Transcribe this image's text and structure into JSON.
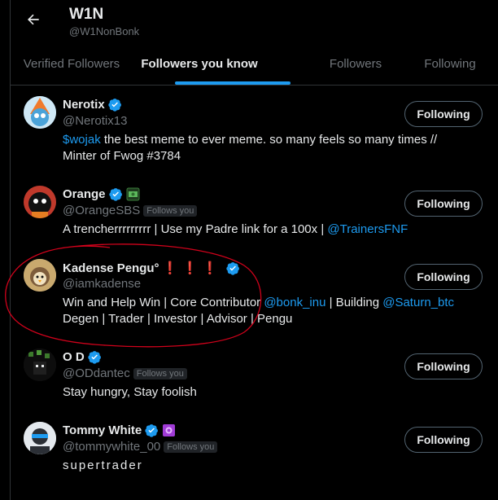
{
  "header": {
    "title": "W1N",
    "handle": "@W1NonBonk"
  },
  "tabs": [
    {
      "label": "Verified Followers",
      "active": false
    },
    {
      "label": "Followers you know",
      "active": true
    },
    {
      "label": "Followers",
      "active": false
    },
    {
      "label": "Following",
      "active": false
    }
  ],
  "colors": {
    "accent": "#1d9bf0",
    "red_annotation": "#d0021b",
    "background": "#000000"
  },
  "users": [
    {
      "name": "Nerotix",
      "handle": "@Nerotix13",
      "follows_you": false,
      "bio_line1_link": "$wojak",
      "bio_line1_rest": " the best meme to ever meme. so many feels so many times //",
      "bio_line2": "Minter of Fwog #3784",
      "button": "Following"
    },
    {
      "name": "Orange",
      "handle": "@OrangeSBS",
      "follows_you": true,
      "follows_you_label": "Follows you",
      "bio_text": "A trencherrrrrrrrr | Use my Padre link for a 100x | ",
      "bio_link": "@TrainersFNF",
      "button": "Following"
    },
    {
      "name": "Kadense Pengu°",
      "name_marks": "❗❗❗",
      "handle": "@iamkadense",
      "follows_you": false,
      "bio_part1": "Win and Help Win | Core Contributor ",
      "bio_link1": "@bonk_inu",
      "bio_part2": " | Building ",
      "bio_link2": "@Saturn_btc",
      "bio_line2": "Degen | Trader | Investor | Advisor | Pengu",
      "button": "Following"
    },
    {
      "name": "O D",
      "handle": "@ODdantec",
      "follows_you": true,
      "follows_you_label": "Follows you",
      "bio_text": "Stay hungry, Stay foolish",
      "button": "Following"
    },
    {
      "name": "Tommy White",
      "handle": "@tommywhite_00",
      "follows_you": true,
      "follows_you_label": "Follows you",
      "bio_text": "supertrader",
      "button": "Following"
    }
  ]
}
